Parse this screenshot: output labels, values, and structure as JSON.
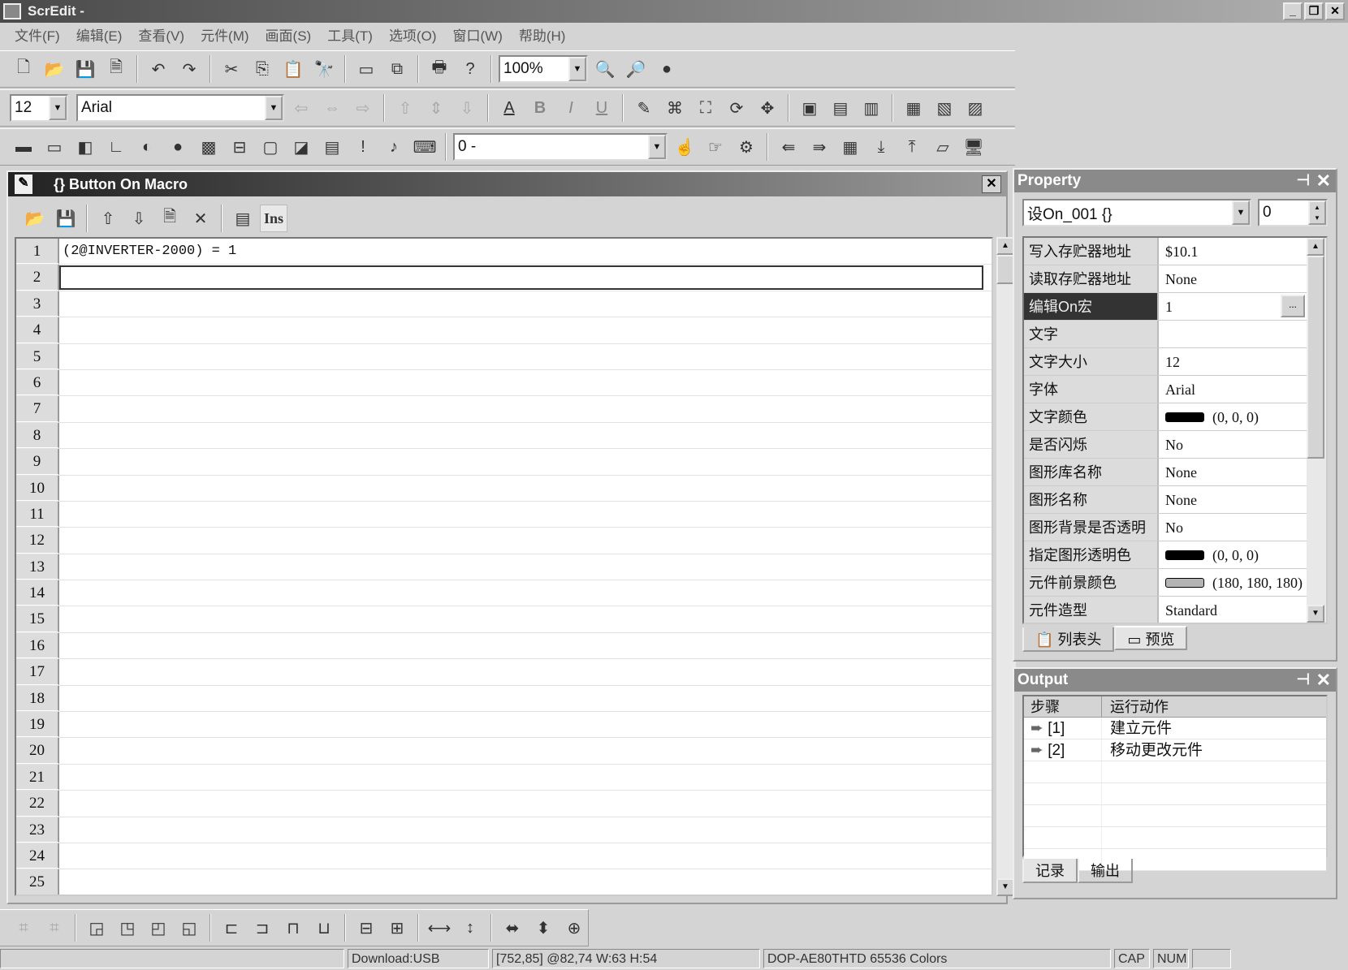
{
  "app": {
    "title": "ScrEdit -"
  },
  "menu": [
    "文件(F)",
    "编辑(E)",
    "查看(V)",
    "元件(M)",
    "画面(S)",
    "工具(T)",
    "选项(O)",
    "窗口(W)",
    "帮助(H)"
  ],
  "toolbar": {
    "zoom": "100%",
    "font_size": "12",
    "font_name": "Arial",
    "layer": "0 -"
  },
  "macro": {
    "title": "{} Button On Macro",
    "ins_label": "Ins",
    "lines": [
      "(2@INVERTER-2000) = 1",
      "",
      "",
      "",
      "",
      "",
      "",
      "",
      "",
      "",
      "",
      "",
      "",
      "",
      "",
      "",
      "",
      "",
      "",
      "",
      "",
      "",
      "",
      "",
      ""
    ],
    "line_numbers": [
      "1",
      "2",
      "3",
      "4",
      "5",
      "6",
      "7",
      "8",
      "9",
      "10",
      "11",
      "12",
      "13",
      "14",
      "15",
      "16",
      "17",
      "18",
      "19",
      "20",
      "21",
      "22",
      "23",
      "24",
      "25"
    ]
  },
  "property": {
    "title": "Property",
    "object": "设On_001 {}",
    "index": "0",
    "rows": [
      {
        "key": "写入存贮器地址",
        "value": "$10.1"
      },
      {
        "key": "读取存贮器地址",
        "value": "None"
      },
      {
        "key": "编辑On宏",
        "value": "1",
        "button": "..."
      },
      {
        "key": "文字",
        "value": ""
      },
      {
        "key": "文字大小",
        "value": "12"
      },
      {
        "key": "字体",
        "value": "Arial"
      },
      {
        "key": "文字颜色",
        "value": "(0, 0, 0)",
        "swatch": "#000000"
      },
      {
        "key": "是否闪烁",
        "value": "No"
      },
      {
        "key": "图形库名称",
        "value": "None"
      },
      {
        "key": "图形名称",
        "value": "None"
      },
      {
        "key": "图形背景是否透明",
        "value": "No"
      },
      {
        "key": "指定图形透明色",
        "value": "(0, 0, 0)",
        "swatch": "#000000"
      },
      {
        "key": "元件前景颜色",
        "value": "(180, 180, 180)",
        "swatch": "#b4b4b4"
      },
      {
        "key": "元件造型",
        "value": "Standard"
      }
    ],
    "tabs": [
      "列表头",
      "预览"
    ]
  },
  "output": {
    "title": "Output",
    "headers": [
      "步骤",
      "运行动作"
    ],
    "rows": [
      {
        "step": "[1]",
        "action": "建立元件"
      },
      {
        "step": "[2]",
        "action": "移动更改元件"
      }
    ],
    "tabs": [
      "记录",
      "输出"
    ]
  },
  "status": {
    "download": "Download:USB",
    "position": "[752,85] @82,74 W:63 H:54",
    "device": "DOP-AE80THTD 65536 Colors",
    "cap": "CAP",
    "num": "NUM"
  }
}
